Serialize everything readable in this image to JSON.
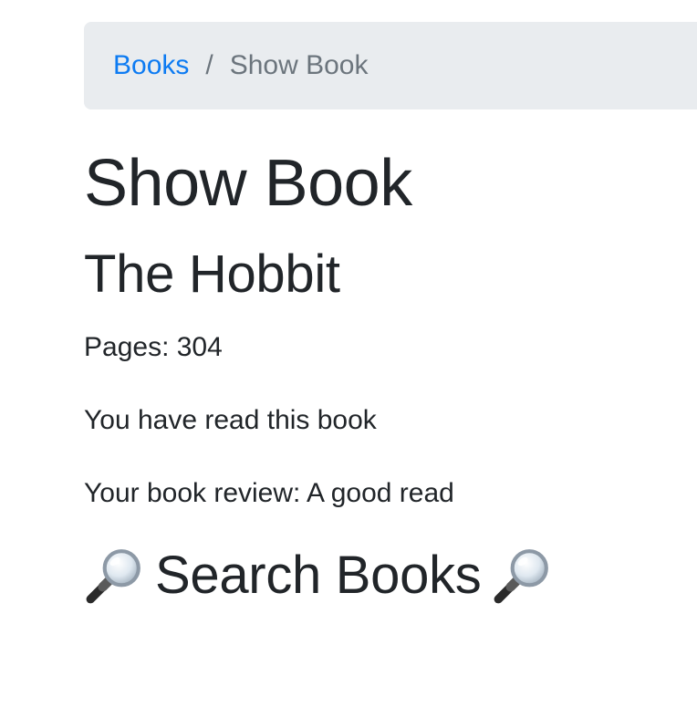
{
  "breadcrumb": {
    "link_label": "Books",
    "separator": "/",
    "current_label": "Show Book"
  },
  "page": {
    "title": "Show Book"
  },
  "book": {
    "title": "The Hobbit",
    "pages_text": "Pages: 304",
    "read_status_text": "You have read this book",
    "review_text": "Your book review: A good read"
  },
  "search": {
    "heading": "Search Books",
    "icon": "magnifying-glass-icon"
  },
  "colors": {
    "link": "#0d7bf2",
    "breadcrumb_bg": "#e9ecef",
    "muted": "#6c757d",
    "text": "#212529"
  }
}
